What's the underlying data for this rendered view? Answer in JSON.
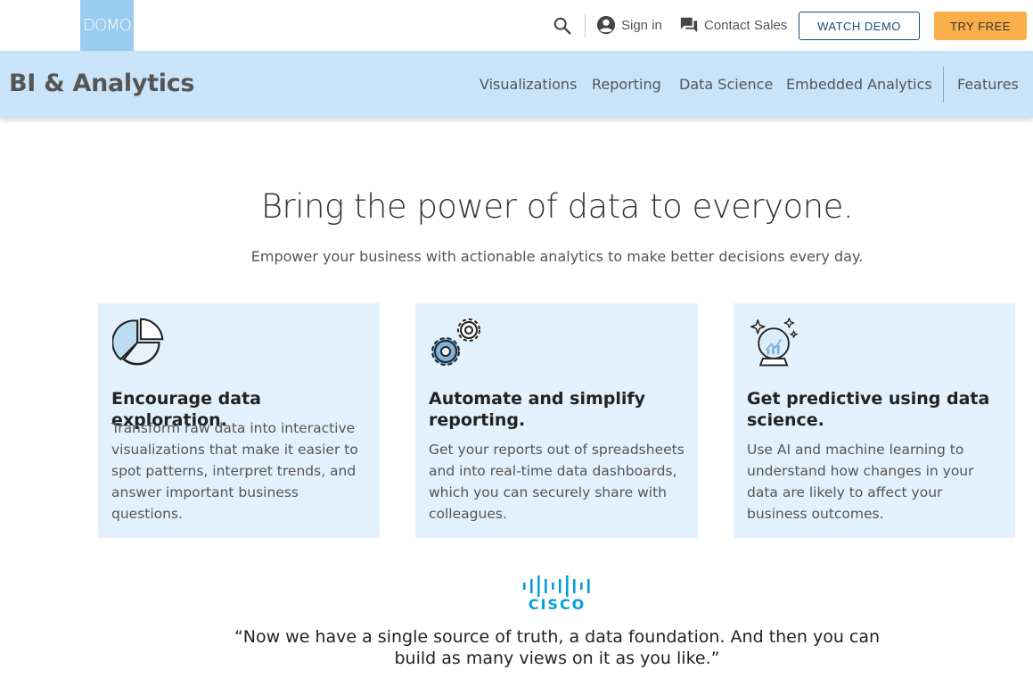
{
  "header": {
    "logo_text": "DOMO",
    "signin_label": "Sign in",
    "contact_label": "Contact Sales",
    "watch_demo_label": "WATCH DEMO",
    "try_free_label": "TRY FREE"
  },
  "subnav": {
    "title": "BI & Analytics",
    "links": [
      "Visualizations",
      "Reporting",
      "Data Science",
      "Embedded Analytics",
      "Features"
    ]
  },
  "hero": {
    "title": "Bring the power of data to everyone.",
    "subtitle": "Empower your business with actionable analytics to make better decisions every day."
  },
  "cards": [
    {
      "icon": "pie-chart-icon",
      "title": "Encourage data exploration.",
      "body": "Transform raw data into interactive visualizations that make it easier to spot patterns, interpret trends, and answer important business questions."
    },
    {
      "icon": "gears-icon",
      "title": "Automate and simplify reporting.",
      "body": "Get your reports out of spreadsheets and into real-time data dashboards, which you can securely share with colleagues."
    },
    {
      "icon": "crystal-ball-icon",
      "title": "Get predictive using data science.",
      "body": "Use AI and machine learning to understand how changes in your data are likely to affect your business outcomes."
    }
  ],
  "testimonial": {
    "logo_text": "CISCO",
    "quote": "“Now we have a single source of truth, a data foundation. And then you can build as many views on it as you like.”"
  },
  "colors": {
    "subnav_bg": "#c9e4f9",
    "card_bg": "#e3f1fc",
    "try_free_bg": "#f9ae4a",
    "watch_demo_border": "#1a4c7a",
    "cisco_blue": "#049fd9",
    "logo_bg": "#99ccee"
  }
}
